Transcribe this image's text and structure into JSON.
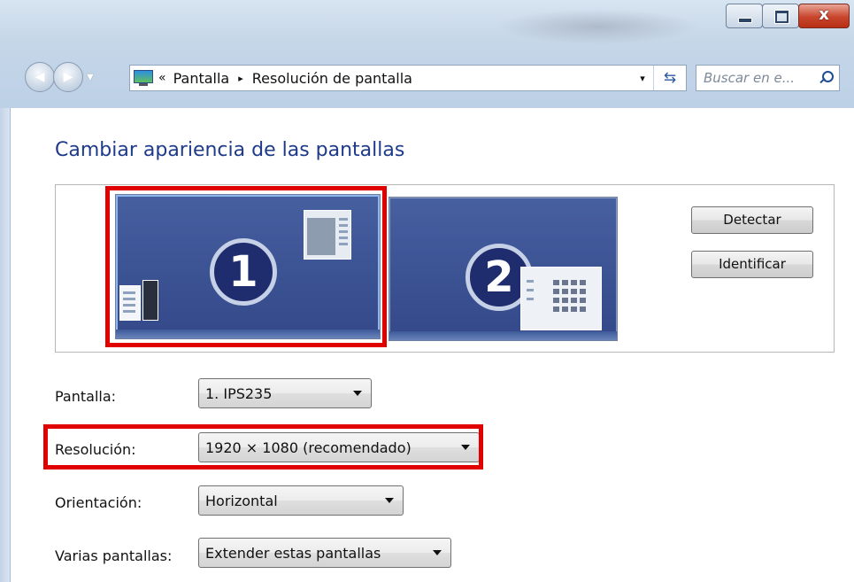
{
  "window": {
    "close_glyph": "x",
    "minimize_icon": "minimize-icon",
    "maximize_icon": "maximize-icon"
  },
  "nav": {
    "back_icon": "back-arrow-icon",
    "forward_icon": "forward-arrow-icon"
  },
  "address": {
    "prefix": "«",
    "crumbs": [
      "Pantalla",
      "Resolución de pantalla"
    ],
    "separator": "▸",
    "dropdown_glyph": "▾",
    "refresh_glyph": "⇆",
    "icon": "display-control-panel-icon"
  },
  "search": {
    "placeholder": "Buscar en e..."
  },
  "page": {
    "title": "Cambiar apariencia de las pantallas"
  },
  "monitors": [
    {
      "number": "1",
      "selected": true
    },
    {
      "number": "2",
      "selected": false
    }
  ],
  "buttons": {
    "detect": "Detectar",
    "identify": "Identificar"
  },
  "settings": [
    {
      "label": "Pantalla:",
      "value": "1. IPS235"
    },
    {
      "label": "Resolución:",
      "value": "1920 × 1080 (recomendado)"
    },
    {
      "label": "Orientación:",
      "value": "Horizontal"
    },
    {
      "label": "Varias pantallas:",
      "value": "Extender estas pantallas"
    }
  ],
  "colors": {
    "title_blue": "#1e3a8a",
    "highlight_red": "#e00000",
    "monitor_blue": "#3a5192"
  }
}
